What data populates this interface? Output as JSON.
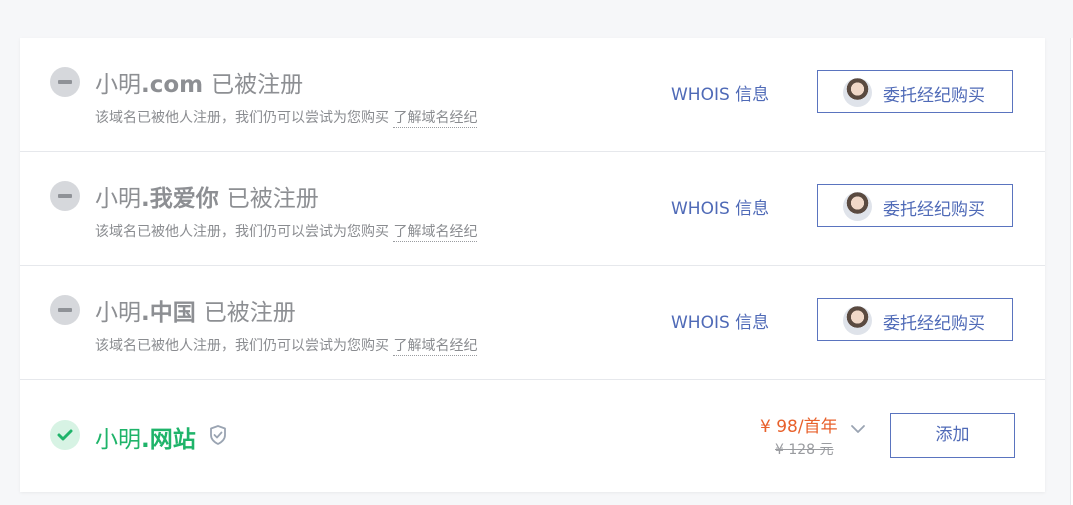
{
  "taken_domains": [
    {
      "name": "小明",
      "suffix": ".com",
      "status": "已被注册",
      "desc": "该域名已被他人注册，我们仍可以尝试为您购买",
      "learn_more": "了解域名经纪",
      "whois": "WHOIS 信息",
      "broker": "委托经纪购买"
    },
    {
      "name": "小明",
      "suffix": ".我爱你",
      "status": "已被注册",
      "desc": "该域名已被他人注册，我们仍可以尝试为您购买",
      "learn_more": "了解域名经纪",
      "whois": "WHOIS 信息",
      "broker": "委托经纪购买"
    },
    {
      "name": "小明",
      "suffix": ".中国",
      "status": "已被注册",
      "desc": "该域名已被他人注册，我们仍可以尝试为您购买",
      "learn_more": "了解域名经纪",
      "whois": "WHOIS 信息",
      "broker": "委托经纪购买"
    }
  ],
  "available_domain": {
    "name": "小明",
    "suffix": ".网站",
    "price": "¥ 98/首年",
    "original_price": "¥ 128 元",
    "add": "添加"
  },
  "colors": {
    "link": "#4f6ab7",
    "available": "#1fb46a",
    "price": "#e8612c",
    "taken_icon": "#d6d8dc"
  },
  "icons": {
    "taken": "minus-circle-icon",
    "available": "check-circle-icon",
    "protect": "shield-check-icon",
    "dropdown": "chevron-down-icon",
    "broker": "avatar"
  }
}
